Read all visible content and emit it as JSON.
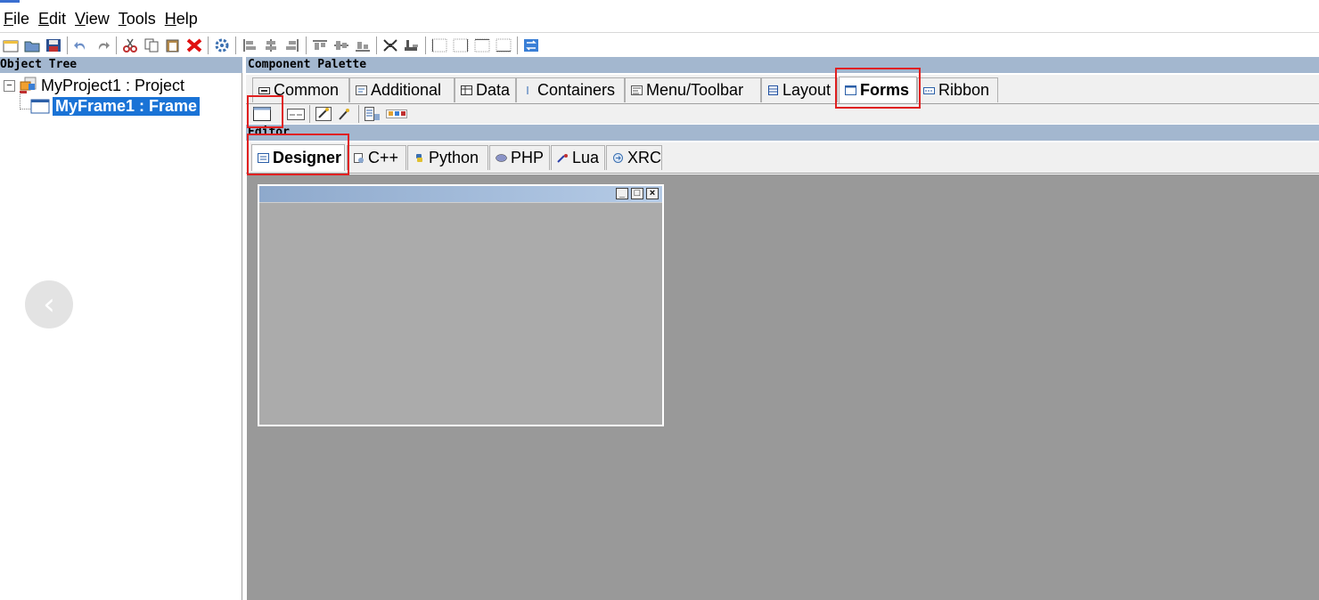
{
  "menu": {
    "items": [
      {
        "accel": "F",
        "rest": "ile"
      },
      {
        "accel": "E",
        "rest": "dit"
      },
      {
        "accel": "V",
        "rest": "iew"
      },
      {
        "accel": "T",
        "rest": "ools"
      },
      {
        "accel": "H",
        "rest": "elp"
      }
    ]
  },
  "object_tree": {
    "header": "Object Tree",
    "expander": "−",
    "project_label": "MyProject1 : Project",
    "frame_label": "MyFrame1 : Frame"
  },
  "palette": {
    "header": "Component Palette",
    "tabs": [
      {
        "label": "Common",
        "icon": "common-icon"
      },
      {
        "label": "Additional",
        "icon": "additional-icon"
      },
      {
        "label": "Data",
        "icon": "data-icon"
      },
      {
        "label": "Containers",
        "icon": "containers-icon"
      },
      {
        "label": "Menu/Toolbar",
        "icon": "menu-toolbar-icon"
      },
      {
        "label": "Layout",
        "icon": "layout-icon"
      },
      {
        "label": "Forms",
        "icon": "forms-icon",
        "active": true
      },
      {
        "label": "Ribbon",
        "icon": "ribbon-icon"
      }
    ]
  },
  "editor": {
    "header": "Editor",
    "tabs": [
      {
        "label": "Designer",
        "icon": "designer-icon",
        "active": true
      },
      {
        "label": "C++",
        "icon": "cpp-icon"
      },
      {
        "label": "Python",
        "icon": "python-icon"
      },
      {
        "label": "PHP",
        "icon": "php-icon"
      },
      {
        "label": "Lua",
        "icon": "lua-icon"
      },
      {
        "label": "XRC",
        "icon": "xrc-icon"
      }
    ]
  },
  "frame_preview": {
    "buttons": [
      "_",
      "□",
      "×"
    ]
  },
  "nav": {
    "back_glyph": "‹"
  },
  "colors": {
    "panel_header": "#a3b7cf",
    "selection": "#1a73d6",
    "canvas": "#999999",
    "highlight": "#e02020"
  }
}
